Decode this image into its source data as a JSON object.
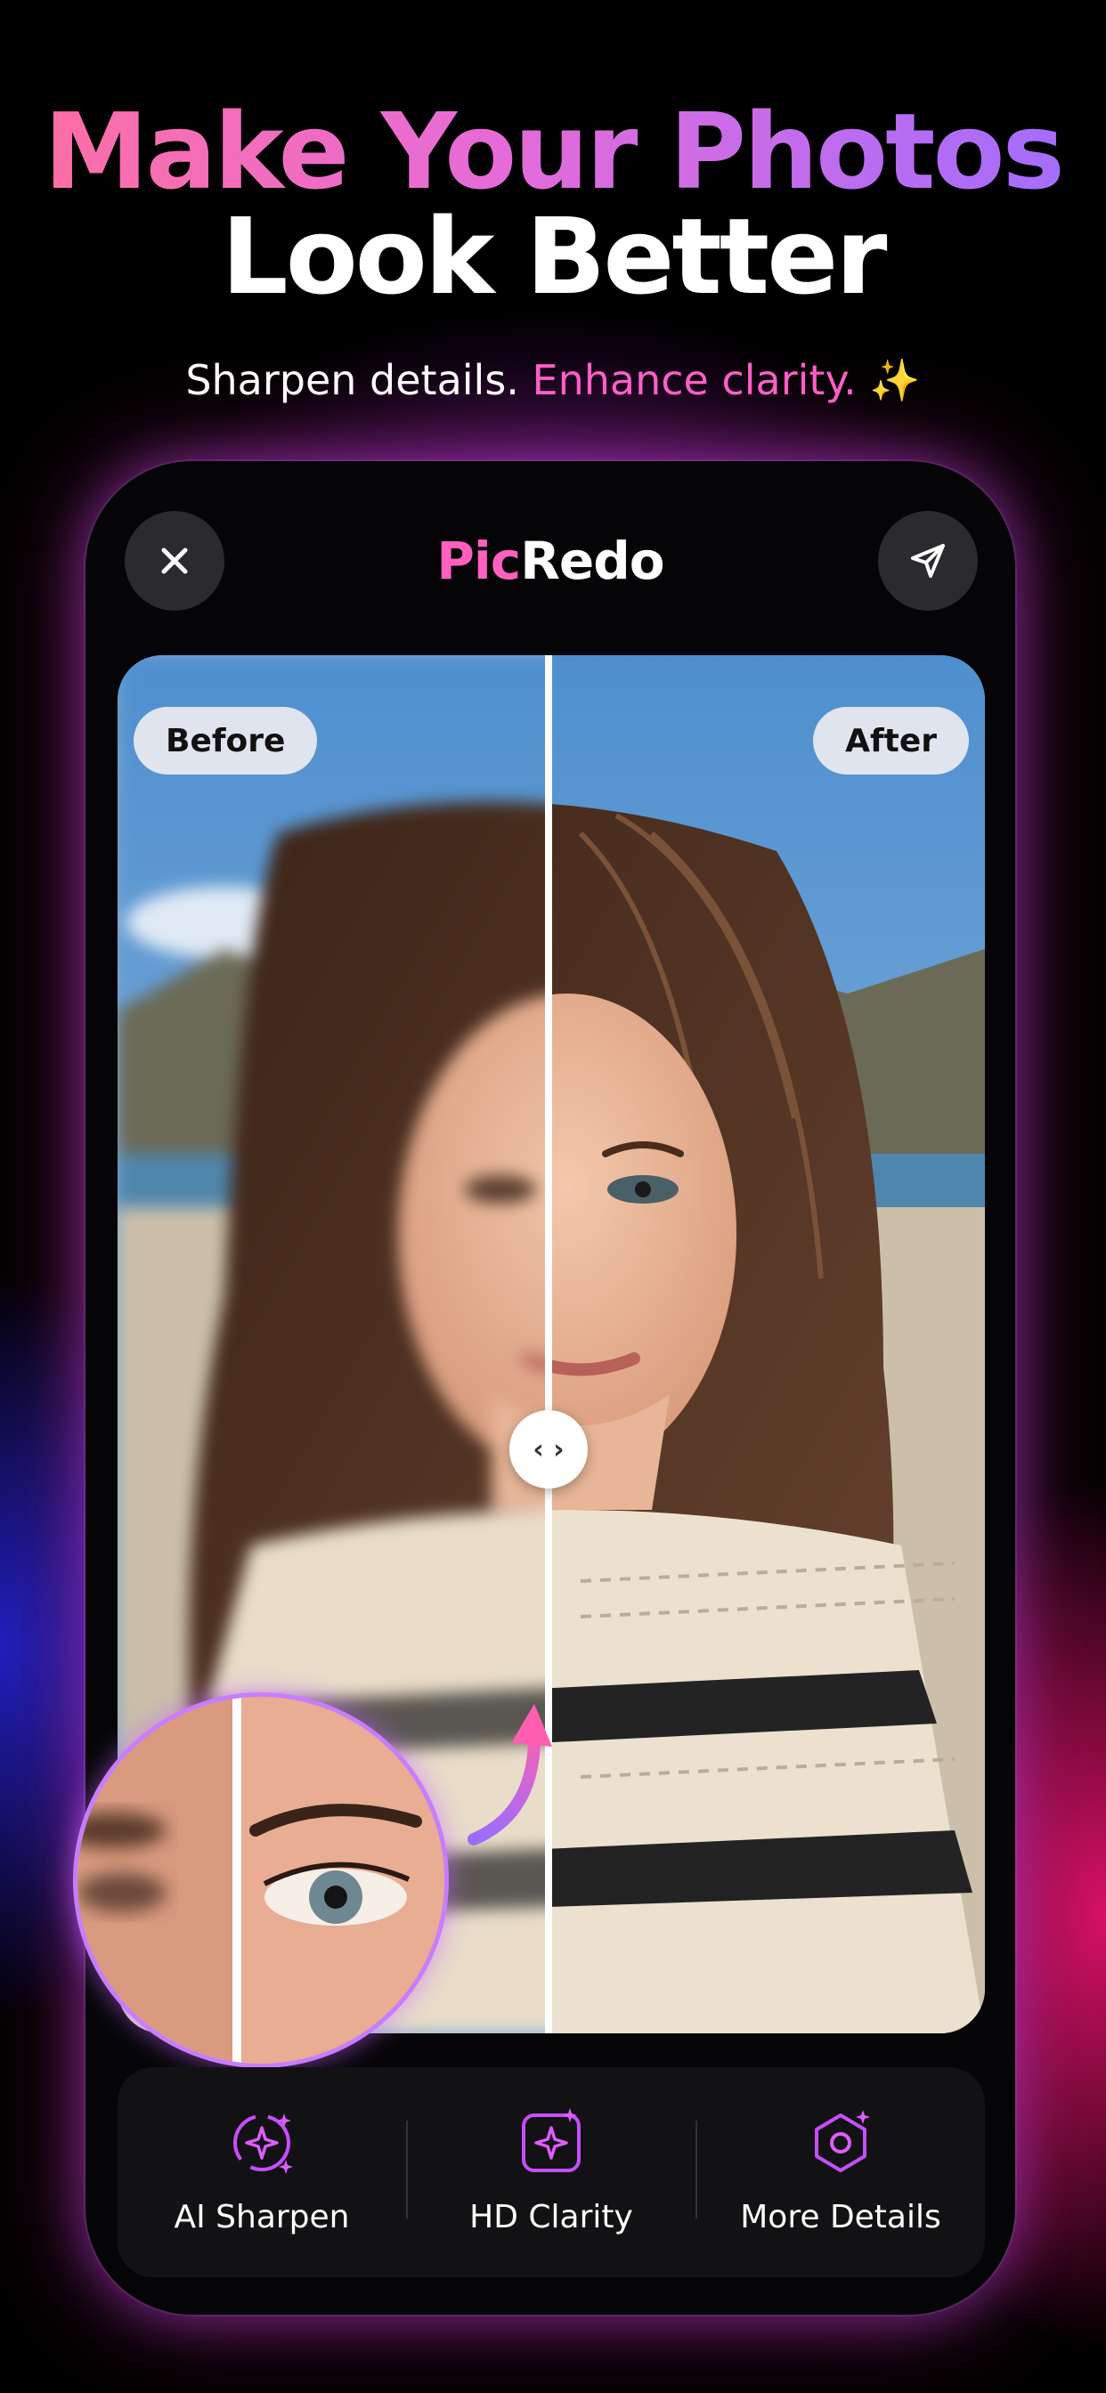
{
  "headline": {
    "line1": "Make Your Photos",
    "line2": "Look Better"
  },
  "subline": {
    "part1": "Sharpen details.",
    "accent": "Enhance clarity.",
    "sparkle": "✨"
  },
  "app": {
    "title_pic": "Pic",
    "title_redo": "Redo",
    "close_icon": "close-icon",
    "share_icon": "send-icon"
  },
  "comparison": {
    "before_label": "Before",
    "after_label": "After",
    "handle_glyph": "‹ ›"
  },
  "tools": [
    {
      "label": "AI Sharpen",
      "icon": "sharpen-sparkle-icon"
    },
    {
      "label": "HD Clarity",
      "icon": "clarity-frame-icon"
    },
    {
      "label": "More Details",
      "icon": "details-gem-icon"
    }
  ],
  "colors": {
    "accent_pink": "#ff5fbf",
    "accent_purple": "#b14dff",
    "background": "#000000"
  }
}
